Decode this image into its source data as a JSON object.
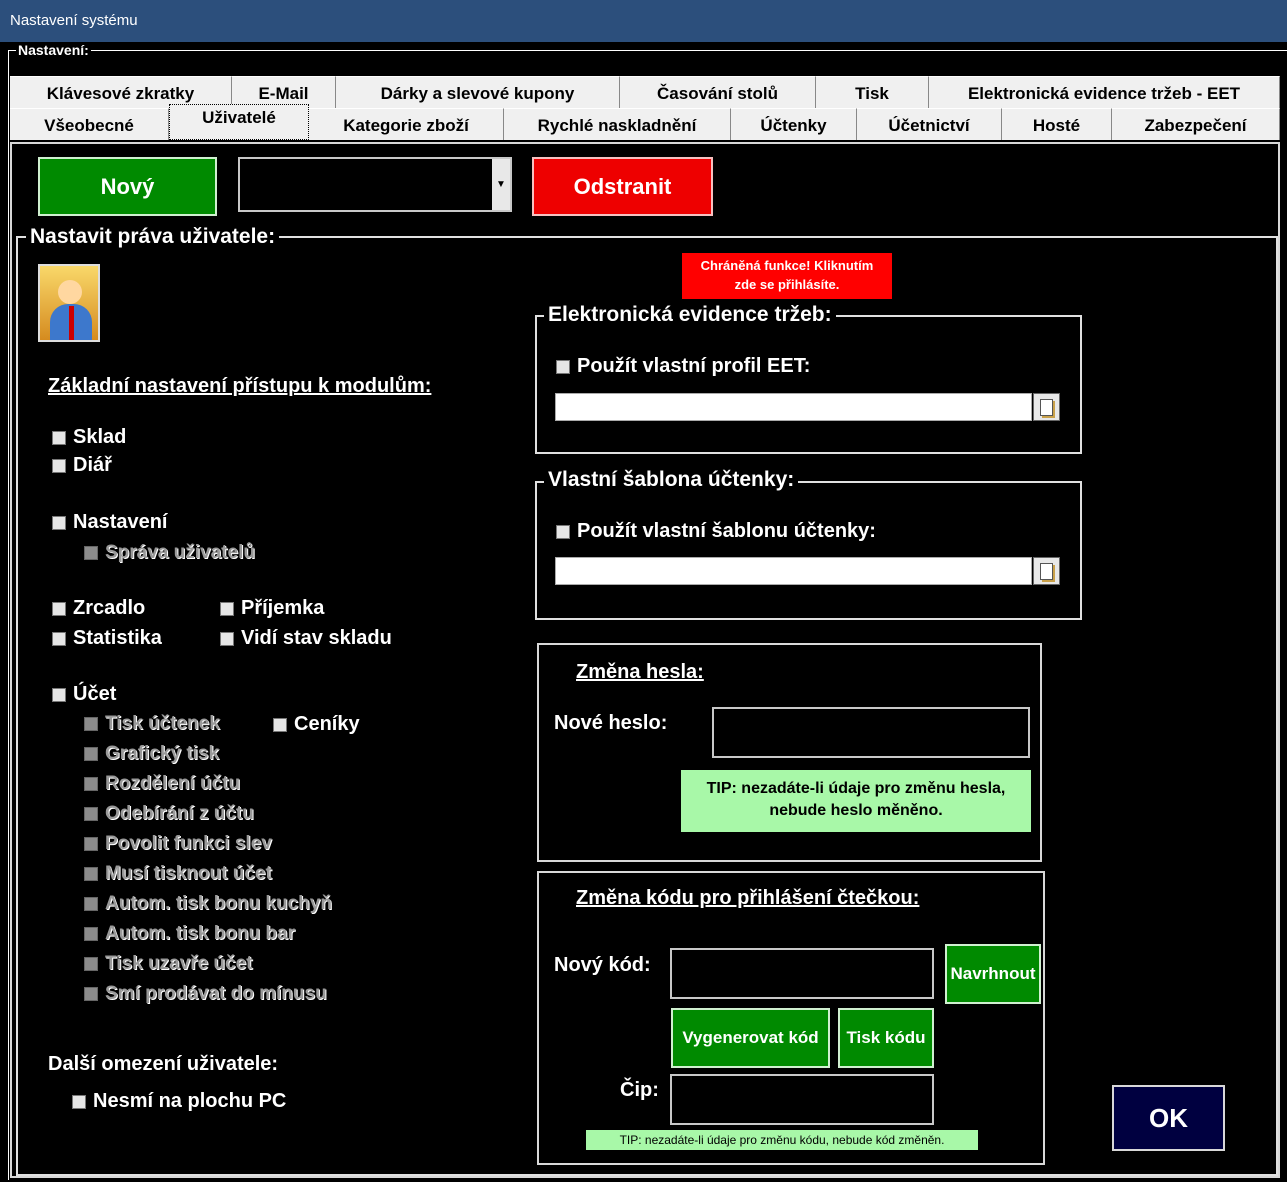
{
  "window": {
    "title": "Nastavení systému"
  },
  "settings": {
    "legend": "Nastavení:"
  },
  "tabs_row1": [
    {
      "label": "Klávesové zkratky"
    },
    {
      "label": "E-Mail"
    },
    {
      "label": "Dárky a slevové kupony"
    },
    {
      "label": "Časování stolů"
    },
    {
      "label": "Tisk"
    },
    {
      "label": "Elektronická evidence tržeb - EET"
    }
  ],
  "tabs_row2": [
    {
      "label": "Všeobecné"
    },
    {
      "label": "Uživatelé",
      "active": true
    },
    {
      "label": "Kategorie zboží"
    },
    {
      "label": "Rychlé naskladnění"
    },
    {
      "label": "Účtenky"
    },
    {
      "label": "Účetnictví"
    },
    {
      "label": "Hosté"
    },
    {
      "label": "Zabezpečení"
    }
  ],
  "toolbar": {
    "new_label": "Nový",
    "remove_label": "Odstranit",
    "user_select_value": ""
  },
  "rights": {
    "legend": "Nastavit práva uživatele:",
    "icon": "user-key-icon",
    "modules_heading": "Základní nastavení přístupu k modulům:",
    "checkboxes": {
      "sklad": "Sklad",
      "diar": "Diář",
      "nastaveni": "Nastavení",
      "sprava_uzivatelu": "Správa uživatelů",
      "zrcadlo": "Zrcadlo",
      "prijemka": "Příjemka",
      "statistika": "Statistika",
      "vidi_stav_skladu": "Vidí stav skladu",
      "ucet": "Účet",
      "tisk_uctenek": "Tisk účtenek",
      "ceniky": "Ceníky",
      "graficky_tisk": "Grafický tisk",
      "rozdeleni_uctu": "Rozdělení účtu",
      "odebirani_z_uctu": "Odebírání z účtu",
      "povolit_funkci_slev": "Povolit funkci slev",
      "musi_tisknout_ucet": "Musí tisknout účet",
      "autom_tisk_kuchyn": "Autom. tisk bonu kuchyň",
      "autom_tisk_bar": "Autom. tisk bonu bar",
      "tisk_uzavre_ucet": "Tisk uzavře účet",
      "smi_prodavat_do_minusu": "Smí prodávat do mínusu"
    },
    "other_heading": "Další omezení uživatele:",
    "nesmi_na_plochu": "Nesmí na plochu PC"
  },
  "protected_notice": {
    "line1": "Chráněná funkce! Kliknutím",
    "line2": "zde se přihlásíte."
  },
  "eet": {
    "legend": "Elektronická evidence tržeb:",
    "checkbox": "Použít vlastní profil EET:",
    "path": ""
  },
  "receipt_template": {
    "legend": "Vlastní šablona účtenky:",
    "checkbox": "Použít vlastní šablonu účtenky:",
    "path": ""
  },
  "password": {
    "heading": "Změna hesla:",
    "label": "Nové heslo:",
    "value": "",
    "tip_line1": "TIP: nezadáte-li údaje pro změnu hesla,",
    "tip_line2": "nebude heslo měněno."
  },
  "reader_code": {
    "heading": "Změna kódu pro přihlášení čtečkou:",
    "code_label": "Nový kód:",
    "code_value": "",
    "suggest_label": "Navrhnout",
    "generate_label": "Vygenerovat kód",
    "print_label": "Tisk kódu",
    "chip_label": "Čip:",
    "chip_value": "",
    "tip": "TIP: nezadáte-li údaje pro změnu kódu, nebude kód změněn."
  },
  "ok_label": "OK"
}
